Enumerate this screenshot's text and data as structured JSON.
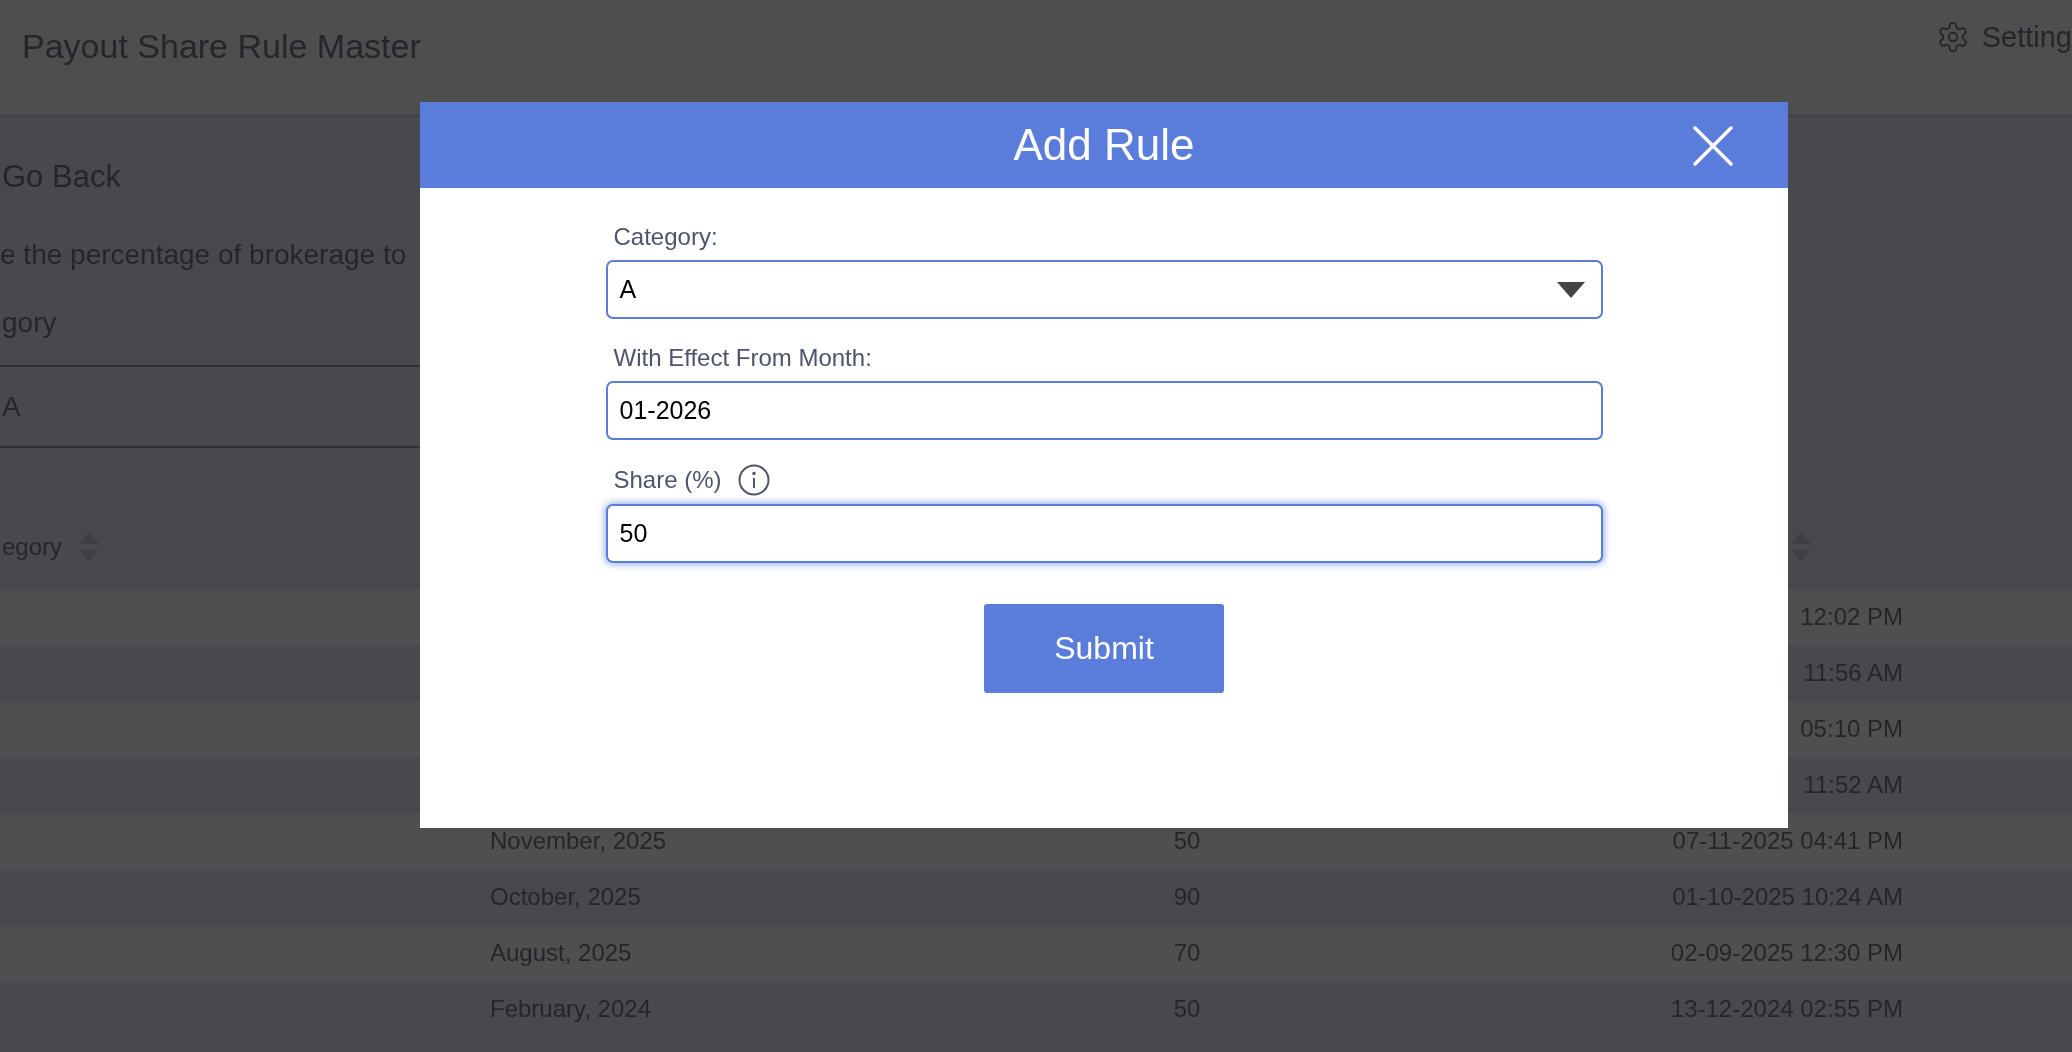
{
  "header": {
    "title": "Payout Share Rule Master",
    "settings_label": "Setting"
  },
  "go_back": "Go Back",
  "description": "e the percentage of brokerage to",
  "category_label": "gory",
  "category_value": "A",
  "table": {
    "category_heading": "egory",
    "rows": [
      {
        "updated": "12:02 PM"
      },
      {
        "updated": "11:56 AM"
      },
      {
        "updated": "05:10 PM"
      },
      {
        "updated": "11:52 AM"
      },
      {
        "month": "November, 2025",
        "share": "50",
        "updated": "07-11-2025 04:41 PM"
      },
      {
        "month": "October, 2025",
        "share": "90",
        "updated": "01-10-2025 10:24 AM"
      },
      {
        "month": "August, 2025",
        "share": "70",
        "updated": "02-09-2025 12:30 PM"
      },
      {
        "month": "February, 2024",
        "share": "50",
        "updated": "13-12-2024 02:55 PM"
      }
    ]
  },
  "modal": {
    "title": "Add Rule",
    "fields": [
      {
        "kind": "select",
        "label": "Category:",
        "value": "A",
        "info": false,
        "focused": false
      },
      {
        "kind": "text",
        "label": "With Effect From Month:",
        "value": "01-2026",
        "info": false,
        "focused": false
      },
      {
        "kind": "text",
        "label": "Share (%)",
        "value": "50",
        "info": true,
        "focused": true
      }
    ],
    "submit": "Submit"
  }
}
